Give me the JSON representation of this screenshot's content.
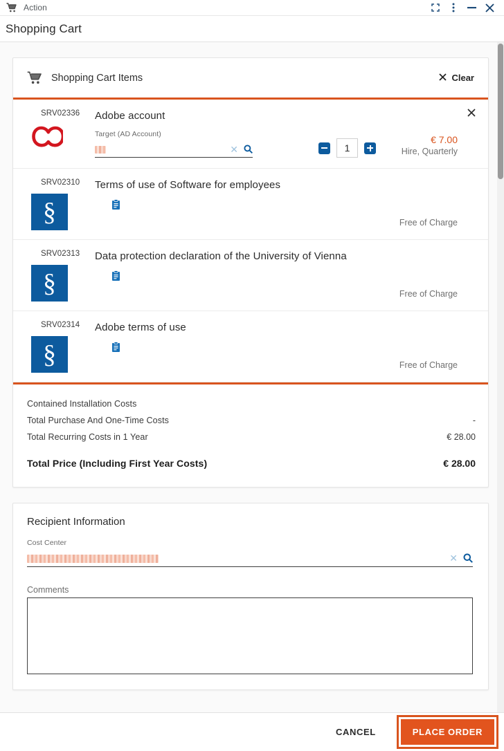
{
  "titlebar": {
    "app_label": "Action",
    "cart_icon": "shopping-cart-icon",
    "buttons": [
      {
        "name": "maximize",
        "icon": "expand-icon"
      },
      {
        "name": "more",
        "icon": "more-vertical-icon"
      },
      {
        "name": "minimize",
        "icon": "minimize-icon"
      },
      {
        "name": "close",
        "icon": "close-icon"
      }
    ]
  },
  "page": {
    "title": "Shopping Cart"
  },
  "cart": {
    "header_title": "Shopping Cart Items",
    "clear_label": "Clear",
    "accent_color": "#d9541e",
    "items": [
      {
        "code": "SRV02336",
        "title": "Adobe account",
        "logo": "adobe-creative-cloud-icon",
        "field_label": "Target (AD Account)",
        "field_value": "",
        "field_redacted": true,
        "quantity": "1",
        "price": "€ 7.00",
        "price_note": "Hire, Quarterly",
        "removable": true
      },
      {
        "code": "SRV02310",
        "title": "Terms of use of Software for employees",
        "logo": "section-sign-icon",
        "logo_glyph": "§",
        "doc_icon": "clipboard-icon",
        "price_note": "Free of Charge",
        "removable": false
      },
      {
        "code": "SRV02313",
        "title": "Data protection declaration of the University of Vienna",
        "logo": "section-sign-icon",
        "logo_glyph": "§",
        "doc_icon": "clipboard-icon",
        "price_note": "Free of Charge",
        "removable": false
      },
      {
        "code": "SRV02314",
        "title": "Adobe terms of use",
        "logo": "section-sign-icon",
        "logo_glyph": "§",
        "doc_icon": "clipboard-icon",
        "price_note": "Free of Charge",
        "removable": false
      }
    ],
    "totals": [
      {
        "label": "Contained Installation Costs",
        "value": ""
      },
      {
        "label": "Total Purchase And One-Time Costs",
        "value": "-"
      },
      {
        "label": "Total Recurring Costs in 1 Year",
        "value": "€ 28.00"
      }
    ],
    "grand_total": {
      "label": "Total Price (Including First Year Costs)",
      "value": "€ 28.00"
    }
  },
  "recipient": {
    "section_title": "Recipient Information",
    "cost_center_label": "Cost Center",
    "cost_center_value": "",
    "cost_center_redacted": true,
    "comments_label": "Comments",
    "comments_value": ""
  },
  "footer": {
    "cancel_label": "CANCEL",
    "place_order_label": "PLACE ORDER"
  }
}
